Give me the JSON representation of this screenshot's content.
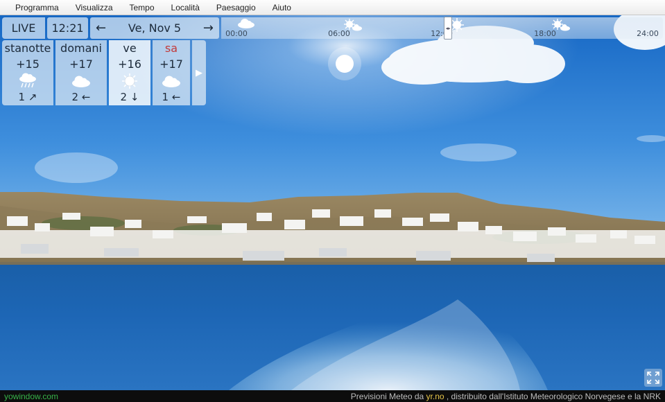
{
  "menu": {
    "items": [
      "Programma",
      "Visualizza",
      "Tempo",
      "Località",
      "Paesaggio",
      "Aiuto"
    ]
  },
  "toppanel": {
    "live_label": "LIVE",
    "time": "12:21",
    "date": "Ve, Nov 5",
    "prev_arrow": "←",
    "next_arrow": "→",
    "timeline_labels": [
      "00:00",
      "06:00",
      "12:00",
      "18:00",
      "24:00"
    ],
    "timeline_current_hour": 12.35
  },
  "forecast": {
    "days": [
      {
        "name": "stanotte",
        "temp": "+15",
        "icon": "cloud-rain-icon",
        "wind": "1 ↗"
      },
      {
        "name": "domani",
        "temp": "+17",
        "icon": "cloud-icon",
        "wind": "2 ←"
      },
      {
        "name": "ve",
        "temp": "+16",
        "icon": "sun-icon",
        "wind": "2 ↓"
      },
      {
        "name": "sa",
        "temp": "+17",
        "icon": "cloud-icon",
        "wind": "1 ←"
      }
    ],
    "next_label": "▶"
  },
  "footer": {
    "brand": "yowindow.com",
    "credit_prefix": "Previsioni Meteo da ",
    "credit_link": "yr.no",
    "credit_suffix": ", distribuito dall'Istituto Meteorologico Norvegese e la NRK"
  },
  "colors": {
    "weekend": "#c23a3a",
    "brand": "#37b34a",
    "link": "#e7c64b"
  }
}
